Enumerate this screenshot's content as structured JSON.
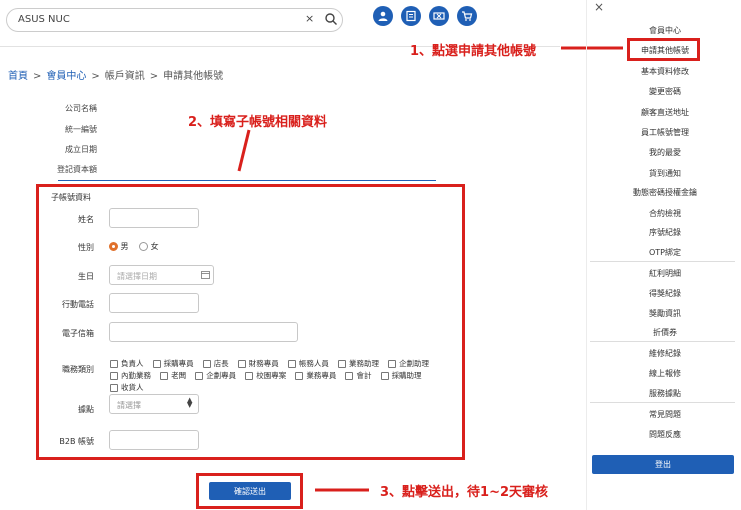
{
  "header": {
    "search_value": "ASUS NUC",
    "clear_symbol": "×"
  },
  "breadcrumb": [
    "首頁",
    "會員中心",
    "帳戶資訊",
    "申請其他帳號"
  ],
  "company_info": {
    "labels": [
      "公司名稱",
      "統一編號",
      "成立日期",
      "登記資本額"
    ]
  },
  "annotations": {
    "step1": "1、點選申請其他帳號",
    "step2": "2、填寫子帳號相關資料",
    "step3": "3、點擊送出，待1~2天審核"
  },
  "form": {
    "title": "子帳號資料",
    "name_label": "姓名",
    "gender_label": "性別",
    "gender_male": "男",
    "gender_female": "女",
    "birthday_label": "生日",
    "birthday_placeholder": "請選擇日期",
    "mobile_label": "行動電話",
    "email_label": "電子信箱",
    "job_label": "職務類別",
    "job_options_row1": [
      "負責人",
      "採購專員",
      "店長",
      "財務專員",
      "帳務人員",
      "業務助理",
      "企劃助理"
    ],
    "job_options_row2": [
      "內勤業務",
      "老闆",
      "企劃專員",
      "校園專案",
      "業務專員",
      "會計",
      "採購助理"
    ],
    "job_options_row3": [
      "收貨人"
    ],
    "location_label": "據點",
    "location_placeholder": "請選擇",
    "b2b_label": "B2B 帳號",
    "submit_label": "確認送出"
  },
  "sidebar": {
    "close_symbol": "×",
    "group1": [
      "會員中心",
      "申請其他帳號",
      "基本資料修改",
      "變更密碼",
      "顧客直送地址",
      "員工帳號管理",
      "我的最愛",
      "貨到通知",
      "動態密碼授權金鑰",
      "合約檢視",
      "序號紀錄",
      "OTP綁定"
    ],
    "group2": [
      "紅利明細",
      "得獎紀錄",
      "獎勵資訊",
      "折價券"
    ],
    "group3": [
      "維修紀錄",
      "線上報修",
      "服務據點"
    ],
    "group4": [
      "常見問題",
      "問題反應"
    ],
    "logout_label": "登出"
  },
  "colors": {
    "accent": "#1f5fb5",
    "highlight": "#d9201c",
    "radio_selected": "#e0702b"
  }
}
